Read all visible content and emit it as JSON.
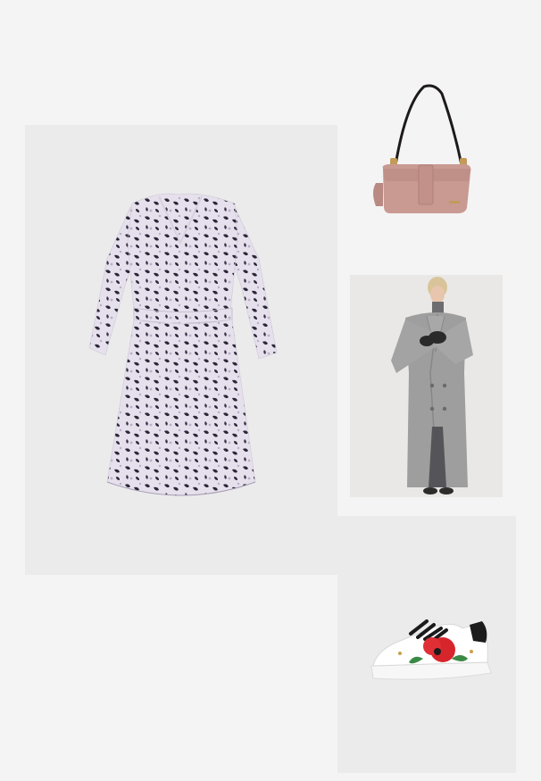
{
  "board": {
    "background": "#f4f4f4",
    "items": [
      {
        "key": "dress",
        "print_colors": [
          "#2b2638",
          "#e9e3ef",
          "#b9aec7"
        ]
      },
      {
        "key": "shoulder-bag",
        "color": "#c99a92"
      },
      {
        "key": "wool-coat",
        "color": "#9e9e9e"
      },
      {
        "key": "floral-sneaker",
        "colors": [
          "#ffffff",
          "#d6262b",
          "#3a8a45",
          "#1b1b1b"
        ]
      }
    ]
  }
}
